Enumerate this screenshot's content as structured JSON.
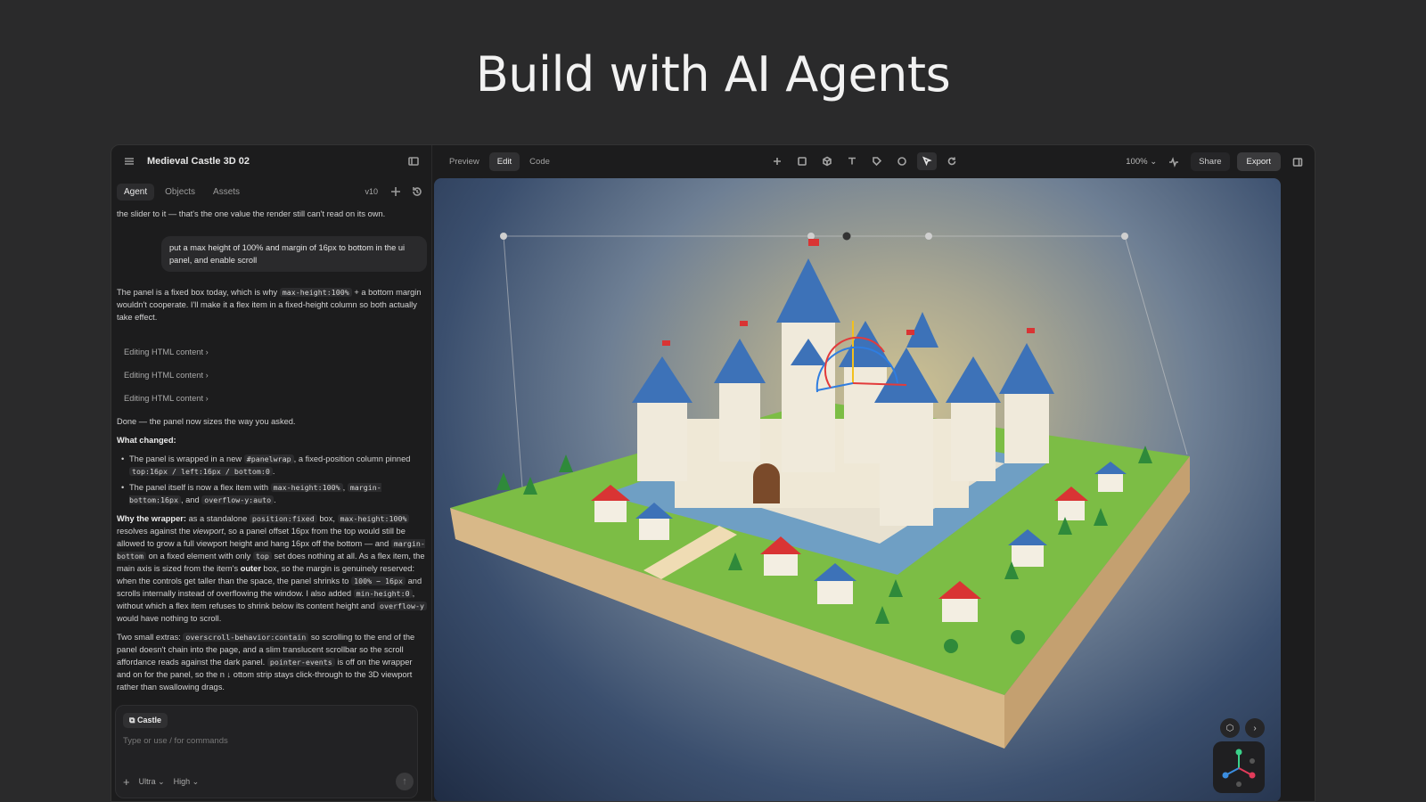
{
  "hero": {
    "title": "Build with AI Agents"
  },
  "panel": {
    "title": "Medieval Castle 3D 02",
    "tabs": [
      "Agent",
      "Objects",
      "Assets"
    ],
    "version": "v10"
  },
  "chat": {
    "intro": "the slider to it — that's the one value the render still can't read on its own.",
    "user_msg": "put a max height of 100% and margin of 16px to bottom in the ui panel, and enable scroll",
    "reply1_a": "The panel is a fixed box today, which is why",
    "reply1_code": "max-height:100%",
    "reply1_b": "+ a bottom margin wouldn't cooperate. I'll make it a flex item in a fixed-height column so both actually take effect.",
    "edits": [
      "Editing HTML content",
      "Editing HTML content",
      "Editing HTML content"
    ],
    "done": "Done — the panel now sizes the way you asked.",
    "what_changed": "What changed:",
    "b1_a": "The panel is wrapped in a new",
    "b1_code1": "#panelwrap",
    "b1_b": ", a fixed-position column pinned",
    "b1_code2": "top:16px / left:16px / bottom:0",
    "b2_a": "The panel itself is now a flex item with",
    "b2_code1": "max-height:100%",
    "b2_code2": "margin-bottom:16px",
    "b2_b": ", and",
    "b2_code3": "overflow-y:auto",
    "why_label": "Why the wrapper:",
    "why_a": "as a standalone",
    "why_code1": "position:fixed",
    "why_b": "box,",
    "why_code2": "max-height:100%",
    "why_c": "resolves against the",
    "why_em": "viewport",
    "why_d": ", so a panel offset 16px from the top would still be allowed to grow a full viewport height and hang 16px off the bottom — and",
    "why_code3": "margin-bottom",
    "why_e": "on a fixed element with only",
    "why_code4": "top",
    "why_f": "set does nothing at all. As a flex item, the main axis is sized from the item's",
    "why_outer": "outer",
    "why_g": "box, so the margin is genuinely reserved: when the controls get taller than the space, the panel shrinks to",
    "why_code5": "100% − 16px",
    "why_h": "and scrolls internally instead of overflowing the window. I also added",
    "why_code6": "min-height:0",
    "why_i": ", without which a flex item refuses to shrink below its content height and",
    "why_code7": "overflow-y",
    "why_j": "would have nothing to scroll.",
    "extras_a": "Two small extras:",
    "extras_code1": "overscroll-behavior:contain",
    "extras_b": "so scrolling to the end of the panel doesn't chain into the page, and a slim translucent scrollbar so the scroll affordance reads against the dark panel.",
    "extras_code2": "pointer-events",
    "extras_c": "is off on the wrapper and on for the panel, so the n",
    "extras_d": "ottom strip stays click-through to the 3D viewport rather than swallowing drags."
  },
  "composer": {
    "chip": "Castle",
    "placeholder": "Type or use / for commands",
    "model": "Ultra",
    "effort": "High"
  },
  "toolbar": {
    "modes": [
      "Preview",
      "Edit",
      "Code"
    ],
    "zoom": "100%",
    "share": "Share",
    "export": "Export"
  },
  "colors": {
    "accent": "#3b6fb6",
    "roof": "#3d72b8",
    "grass": "#7cbd45",
    "flag": "#d93434"
  }
}
